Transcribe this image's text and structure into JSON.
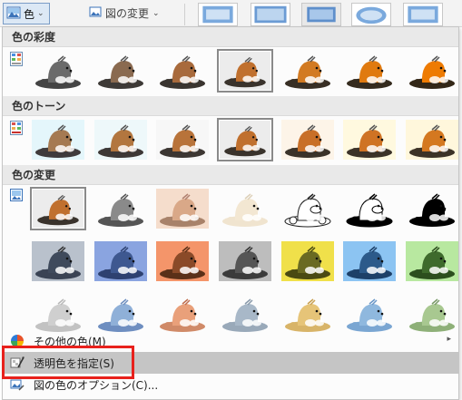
{
  "ribbon": {
    "color_button": {
      "label": "色",
      "icon": "picture-color-icon",
      "chevron": "⌄"
    },
    "change_picture": {
      "label": "図の変更",
      "chevron": "⌄",
      "icon": "change-picture-icon"
    }
  },
  "sections": [
    {
      "title": "色の彩度",
      "icon": "saturation-icon"
    },
    {
      "title": "色のトーン",
      "icon": "tone-icon"
    },
    {
      "title": "色の変更",
      "icon": "recolor-icon"
    }
  ],
  "menu": {
    "more_colors": {
      "label": "その他の色(M)",
      "icon": "color-wheel-icon",
      "arrow": "▸"
    },
    "set_transparent": {
      "label": "透明色を指定(S)",
      "icon": "set-transparent-color-icon"
    },
    "options": {
      "label": "図の色のオプション(C)...",
      "icon": "picture-color-options-icon"
    }
  },
  "colors": {
    "accent_highlight": "#e8211c",
    "hover_gray": "#c5c5c5",
    "header_gray": "#e9e9e9"
  },
  "saturation_row": [
    {
      "body": "#6b6b6b",
      "tuft": "#555555",
      "mound": "#444444",
      "bg": "none"
    },
    {
      "body": "#8a6a50",
      "tuft": "#555555",
      "mound": "#3e3a37",
      "bg": "none"
    },
    {
      "body": "#a86a3c",
      "tuft": "#555555",
      "mound": "#3a3530",
      "bg": "none"
    },
    {
      "body": "#c0702e",
      "tuft": "#555555",
      "mound": "#3a332c",
      "bg": "none",
      "selected": true
    },
    {
      "body": "#d27a22",
      "tuft": "#555555",
      "mound": "#382f25",
      "bg": "none"
    },
    {
      "body": "#e07a10",
      "tuft": "#555555",
      "mound": "#352b1e",
      "bg": "none"
    },
    {
      "body": "#ee7b02",
      "tuft": "#555555",
      "mound": "#332717",
      "bg": "none"
    }
  ],
  "tone_row": [
    {
      "body": "#a57a52",
      "tuft": "#555555",
      "mound": "#3f3b3c",
      "bg": "#e4f6fb"
    },
    {
      "body": "#b2763f",
      "tuft": "#555555",
      "mound": "#3d3836",
      "bg": "#eef8fa"
    },
    {
      "body": "#b8733a",
      "tuft": "#555555",
      "mound": "#3c3632",
      "bg": "#f7f7f7"
    },
    {
      "body": "#c0702e",
      "tuft": "#555555",
      "mound": "#3a332c",
      "bg": "none",
      "selected": true
    },
    {
      "body": "#c86f28",
      "tuft": "#555555",
      "mound": "#3b3329",
      "bg": "#fdf4e8"
    },
    {
      "body": "#cf7324",
      "tuft": "#555555",
      "mound": "#3c3328",
      "bg": "#fff9df"
    },
    {
      "body": "#d47820",
      "tuft": "#555555",
      "mound": "#3d3326",
      "bg": "#fff7dc"
    }
  ],
  "recolor_rows": [
    [
      {
        "body": "#c0702e",
        "tuft": "#555555",
        "mound": "#3a332c",
        "bg": "none",
        "selected": true
      },
      {
        "body": "#8a8a8a",
        "tuft": "#555555",
        "mound": "#555555",
        "bg": "none"
      },
      {
        "body": "#d9a888",
        "tuft": "#b08070",
        "mound": "#a8826a",
        "bg": "#f5ddcc"
      },
      {
        "body": "#f3e7d2",
        "tuft": "#ddd0b8",
        "mound": "#f0e4cf",
        "bg": "none"
      },
      {
        "body": "#ffffff",
        "tuft": "#222222",
        "mound": "#ffffff",
        "bg": "none",
        "stroke": "#222222"
      },
      {
        "body": "#ffffff",
        "tuft": "#000000",
        "mound": "#000000",
        "bg": "none",
        "stroke": "#000000"
      },
      {
        "body": "#000000",
        "tuft": "#000000",
        "mound": "#000000",
        "bg": "none"
      }
    ],
    [
      {
        "body": "#3f4a5c",
        "tuft": "#333333",
        "mound": "#3a4354",
        "bg": "#b9c1cc"
      },
      {
        "body": "#3e5890",
        "tuft": "#2f4372",
        "mound": "#2e4170",
        "bg": "#8aa4e0"
      },
      {
        "body": "#8a4a28",
        "tuft": "#5a3018",
        "mound": "#5a3018",
        "bg": "#f4956a"
      },
      {
        "body": "#555555",
        "tuft": "#333333",
        "mound": "#3b3b3b",
        "bg": "#bdbdbd"
      },
      {
        "body": "#6a6a22",
        "tuft": "#4a4a12",
        "mound": "#4a4a12",
        "bg": "#f0e04a"
      },
      {
        "body": "#2c5a8a",
        "tuft": "#1d4068",
        "mound": "#1d4068",
        "bg": "#8cc4f2"
      },
      {
        "body": "#3e6a2c",
        "tuft": "#2c4e1e",
        "mound": "#2c4e1e",
        "bg": "#b8e8a0"
      }
    ],
    [
      {
        "body": "#cfcfcf",
        "tuft": "#b8b8b8",
        "mound": "#c2c2c2",
        "bg": "none"
      },
      {
        "body": "#8fb0d8",
        "tuft": "#6f90c0",
        "mound": "#6e8ec0",
        "bg": "none"
      },
      {
        "body": "#e9a07a",
        "tuft": "#c07050",
        "mound": "#d08a68",
        "bg": "none"
      },
      {
        "body": "#a8b8c8",
        "tuft": "#8899aa",
        "mound": "#99a9b9",
        "bg": "none"
      },
      {
        "body": "#e6c478",
        "tuft": "#c8a050",
        "mound": "#d8b468",
        "bg": "none"
      },
      {
        "body": "#8fb8de",
        "tuft": "#6a98c8",
        "mound": "#7aa6d2",
        "bg": "none"
      },
      {
        "body": "#a8c890",
        "tuft": "#7a9a68",
        "mound": "#8eb078",
        "bg": "none"
      }
    ]
  ]
}
